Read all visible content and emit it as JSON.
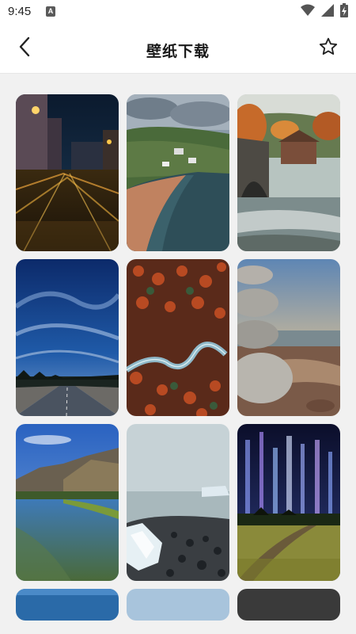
{
  "status_bar": {
    "time": "9:45",
    "notification_badge": "A",
    "icons": [
      "wifi-icon",
      "cellular-signal-icon",
      "battery-charging-icon"
    ]
  },
  "header": {
    "title": "壁纸下载",
    "back_icon": "chevron-left-icon",
    "favorite_icon": "star-outline-icon"
  },
  "wallpapers": [
    {
      "id": "night-city-street"
    },
    {
      "id": "coastal-village"
    },
    {
      "id": "stone-bridge-river"
    },
    {
      "id": "starry-sky-road"
    },
    {
      "id": "aerial-winding-road"
    },
    {
      "id": "stacked-stones-beach"
    },
    {
      "id": "mountain-lake"
    },
    {
      "id": "icy-pebble-shore"
    },
    {
      "id": "aurora-meadow"
    }
  ],
  "colors": {
    "background": "#f1f1f1",
    "header_bg": "#ffffff",
    "title": "#1a1a1a"
  }
}
